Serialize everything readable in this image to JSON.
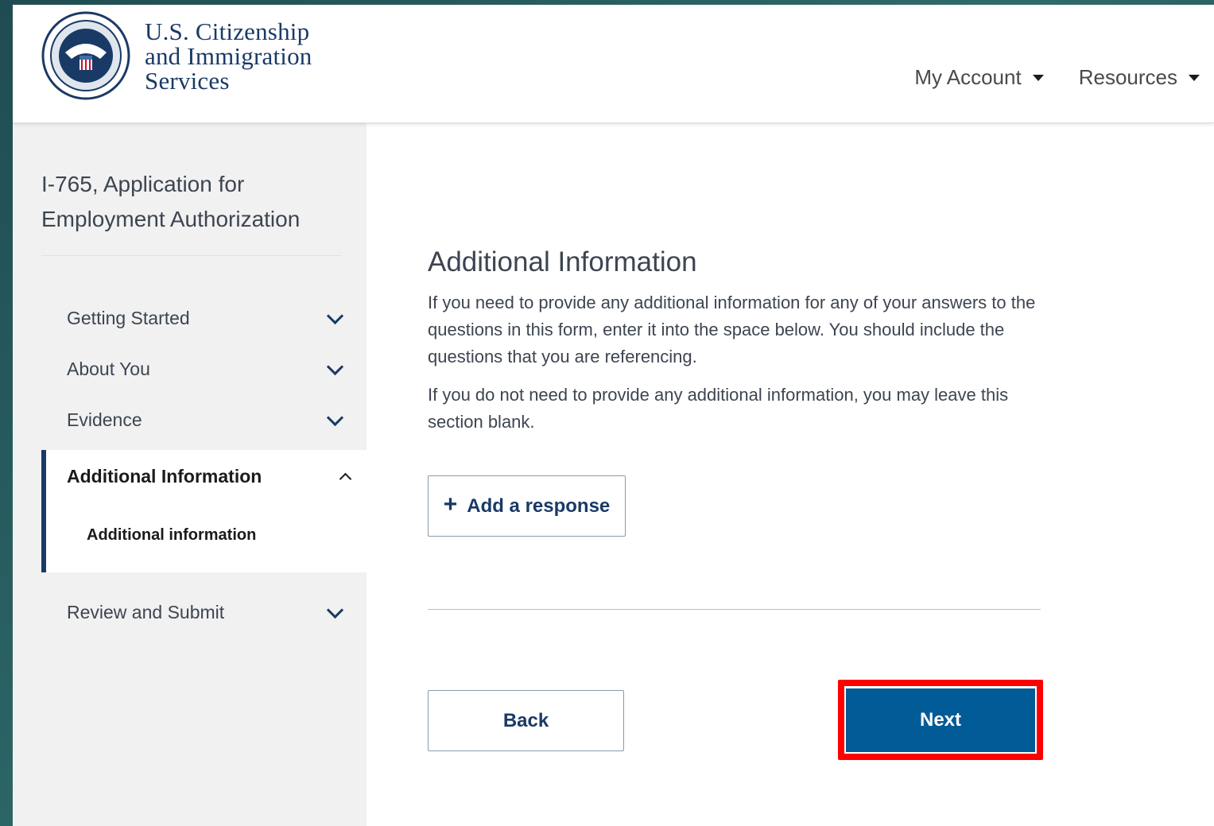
{
  "header": {
    "agency_line1": "U.S. Citizenship",
    "agency_line2": "and Immigration",
    "agency_line3": "Services",
    "nav": {
      "my_account": "My Account",
      "resources": "Resources"
    }
  },
  "sidebar": {
    "form_title": "I-765, Application for Employment Authorization",
    "items": [
      {
        "label": "Getting Started",
        "state": "collapsed"
      },
      {
        "label": "About You",
        "state": "collapsed"
      },
      {
        "label": "Evidence",
        "state": "collapsed"
      },
      {
        "label": "Additional Information",
        "state": "expanded",
        "subitems": [
          "Additional information"
        ]
      },
      {
        "label": "Review and Submit",
        "state": "collapsed"
      }
    ]
  },
  "main": {
    "title": "Additional Information",
    "paragraph1": "If you need to provide any additional information for any of your answers to the questions in this form, enter it into the space below. You should include the questions that you are referencing.",
    "paragraph2": "If you do not need to provide any additional information, you may leave this section blank.",
    "add_response_label": "Add a response",
    "back_label": "Back",
    "next_label": "Next"
  },
  "colors": {
    "primary_blue": "#005b96",
    "navy": "#1a3a66",
    "highlight_red": "#ff0000",
    "sidebar_bg": "#f1f1f1"
  },
  "icons": {
    "seal": "dhs-seal-icon",
    "caret": "caret-down-icon",
    "chevron_down": "chevron-down-icon",
    "chevron_up": "chevron-up-icon",
    "plus": "plus-icon"
  }
}
